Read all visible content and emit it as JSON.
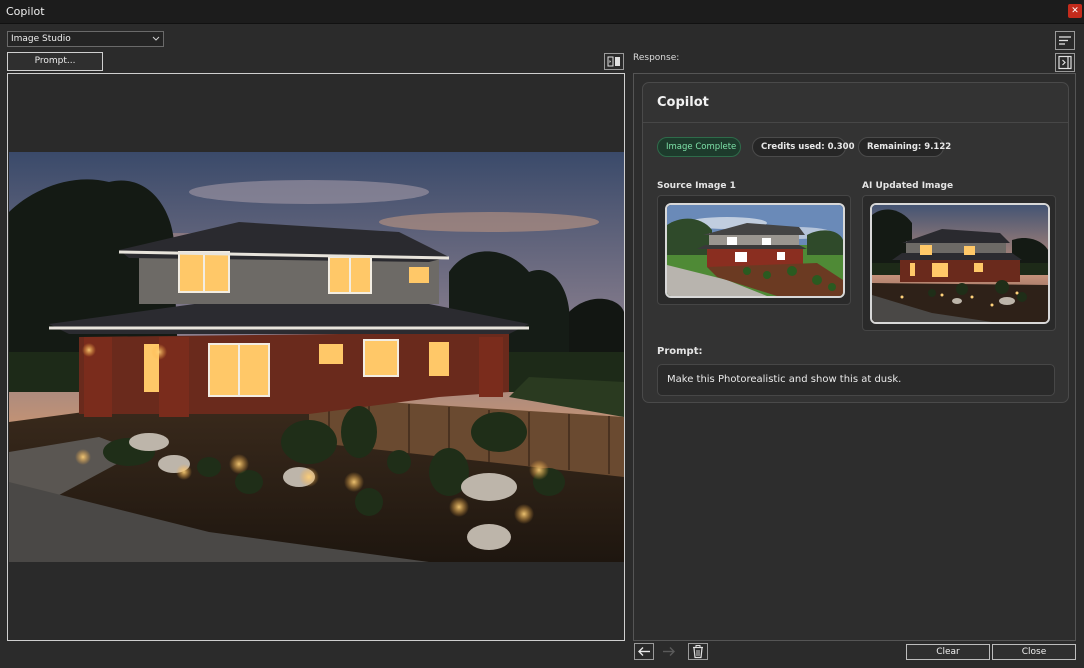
{
  "window": {
    "title": "Copilot"
  },
  "toolbar": {
    "mode_select": "Image Studio",
    "prompt_button": "Prompt..."
  },
  "response": {
    "label": "Response:",
    "card": {
      "title": "Copilot",
      "badges": {
        "status": "Image Complete",
        "credits": "Credits used: 0.300",
        "remaining": "Remaining: 9.122"
      },
      "source_label": "Source Image 1",
      "updated_label": "AI Updated Image",
      "prompt_label": "Prompt:",
      "prompt_text": "Make this Photorealistic and show this at dusk."
    }
  },
  "footer": {
    "clear": "Clear",
    "close": "Close"
  },
  "icons": {
    "close": "close-icon",
    "chevron": "chevron-down-icon",
    "swap": "swap-panel-icon",
    "sort": "sort-lines-icon",
    "panel": "collapse-panel-icon",
    "back": "arrow-left-icon",
    "forward": "arrow-right-icon",
    "trash": "trash-icon"
  },
  "colors": {
    "accent_green": "#7ee2a8",
    "close_red": "#c42b1c",
    "background": "#2b2b2b"
  }
}
